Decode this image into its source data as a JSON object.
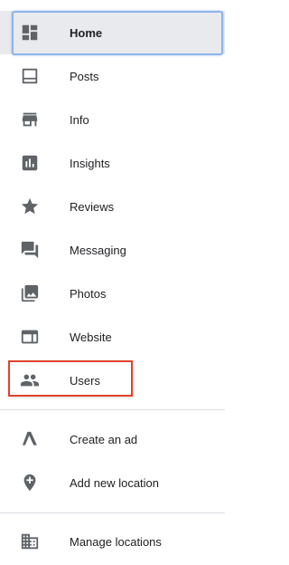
{
  "nav": {
    "items": [
      {
        "label": "Home",
        "icon": "dashboard-icon",
        "active": true
      },
      {
        "label": "Posts",
        "icon": "posts-icon"
      },
      {
        "label": "Info",
        "icon": "store-icon"
      },
      {
        "label": "Insights",
        "icon": "insights-icon"
      },
      {
        "label": "Reviews",
        "icon": "star-icon"
      },
      {
        "label": "Messaging",
        "icon": "chat-icon"
      },
      {
        "label": "Photos",
        "icon": "photos-icon"
      },
      {
        "label": "Website",
        "icon": "website-icon"
      },
      {
        "label": "Users",
        "icon": "users-icon",
        "highlighted": true
      }
    ],
    "secondary": [
      {
        "label": "Create an ad",
        "icon": "google-ads-icon"
      },
      {
        "label": "Add new location",
        "icon": "add-location-icon"
      }
    ],
    "tertiary": [
      {
        "label": "Manage locations",
        "icon": "building-icon"
      }
    ]
  },
  "colors": {
    "icon": "#5f6368",
    "text": "#202124",
    "active_bg": "#e8eaed",
    "highlight_border": "#e0432c",
    "focus_border": "#8fb4ec"
  }
}
